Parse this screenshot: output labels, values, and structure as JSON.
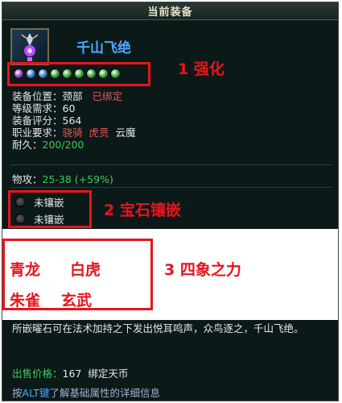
{
  "panel": {
    "title": "当前装备"
  },
  "item": {
    "name": "千山飞绝",
    "gems": [
      {
        "color": "#9b4fd1"
      },
      {
        "color": "#3f8fe0"
      },
      {
        "color": "#3f8fe0"
      },
      {
        "color": "#46b84a"
      },
      {
        "color": "#46b84a"
      },
      {
        "color": "#46b84a"
      },
      {
        "color": "#46b84a"
      },
      {
        "color": "#46b84a"
      },
      {
        "color": "#46b84a"
      }
    ],
    "stats": {
      "slot_label": "装备位置：",
      "slot_value": "颈部",
      "bound": "已绑定",
      "level_label": "等级需求：",
      "level_value": "60",
      "score_label": "装备评分：",
      "score_value": "564",
      "class_label": "职业要求：",
      "class_1": "骁骑",
      "class_2": "虎贲",
      "class_3": "云魔",
      "durability_label": "耐久：",
      "durability_value": "200/200"
    },
    "attack": {
      "label": "物攻：",
      "value": "25-38 (+59%)"
    },
    "sockets": [
      "未镶嵌",
      "未镶嵌"
    ],
    "description": "所嵌曜石可在法术加持之下发出悦耳鸣声，众鸟逐之，千山飞绝。",
    "price": {
      "label": "出售价格：",
      "value": "167",
      "unit": "绑定天币"
    },
    "hint": {
      "prefix": "按",
      "key": "ALT键",
      "suffix": "了解基础属性的详细信息"
    }
  },
  "annotations": {
    "one": "1  强化",
    "two": "2    宝石镶嵌",
    "three": "3  四象之力"
  },
  "four_symbols": {
    "qinglong": "青龙",
    "baihu": "白虎",
    "zhuque": "朱雀",
    "xuanwu": "玄武"
  }
}
